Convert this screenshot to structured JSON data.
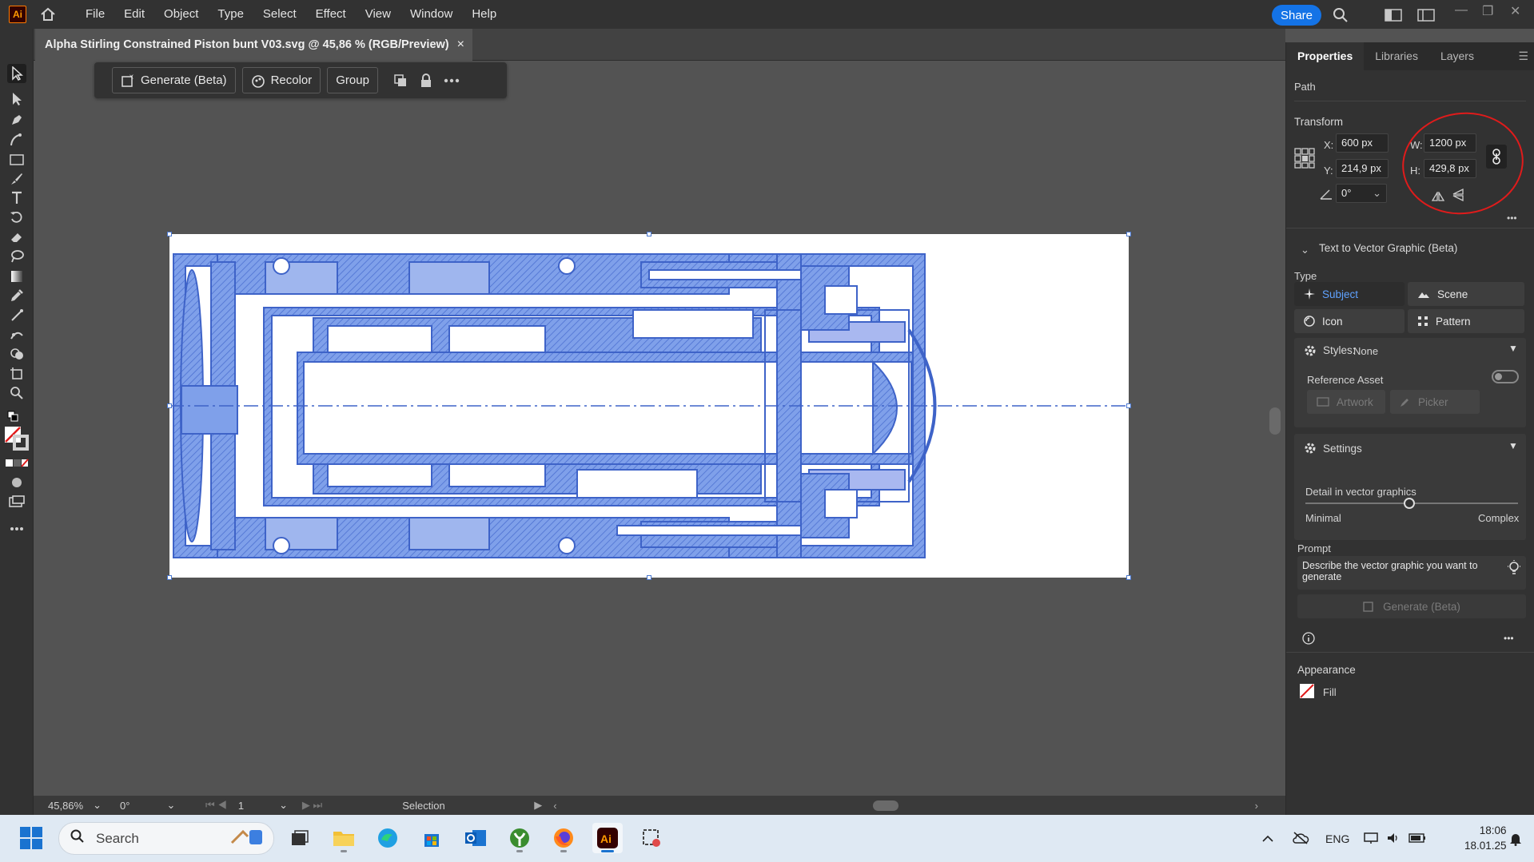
{
  "app": {
    "logo_text": "Ai",
    "menu": [
      "File",
      "Edit",
      "Object",
      "Type",
      "Select",
      "Effect",
      "View",
      "Window",
      "Help"
    ],
    "share_label": "Share"
  },
  "document": {
    "tab_title": "Alpha Stirling Constrained Piston bunt V03.svg @ 45,86 % (RGB/Preview)",
    "close_glyph": "×"
  },
  "context_bar": {
    "generate_label": "Generate (Beta)",
    "recolor_label": "Recolor",
    "group_label": "Group"
  },
  "status_bar": {
    "zoom": "45,86%",
    "rotation": "0°",
    "artboard_number": "1",
    "tool_name": "Selection"
  },
  "panel": {
    "tabs": [
      "Properties",
      "Libraries",
      "Layers"
    ],
    "object_type": "Path",
    "transform": {
      "heading": "Transform",
      "x_label": "X:",
      "x": "600 px",
      "y_label": "Y:",
      "y": "214,9 px",
      "w_label": "W:",
      "w": "1200 px",
      "h_label": "H:",
      "h": "429,8 px",
      "angle": "0°"
    },
    "text_to_vector": {
      "heading": "Text to Vector Graphic (Beta)",
      "type_label": "Type",
      "types": [
        "Subject",
        "Scene",
        "Icon",
        "Pattern"
      ],
      "styles_label": "Styles:",
      "styles_value": "None",
      "reference_label": "Reference Asset",
      "artwork_label": "Artwork",
      "picker_label": "Picker",
      "settings_label": "Settings",
      "detail_label": "Detail in vector graphics",
      "detail_value": 0.49,
      "detail_min": "Minimal",
      "detail_max": "Complex",
      "prompt_label": "Prompt",
      "prompt_placeholder": "Describe the vector graphic you want to generate",
      "generate_label": "Generate (Beta)"
    },
    "appearance": {
      "heading": "Appearance",
      "fill_label": "Fill"
    }
  },
  "taskbar": {
    "search_placeholder": "Search",
    "language": "ENG",
    "time": "18:06",
    "date": "18.01.25"
  },
  "colors": {
    "accent": "#1473e6",
    "drawing_blue": "#4a78d6",
    "annotation_red": "#e01b1b"
  }
}
